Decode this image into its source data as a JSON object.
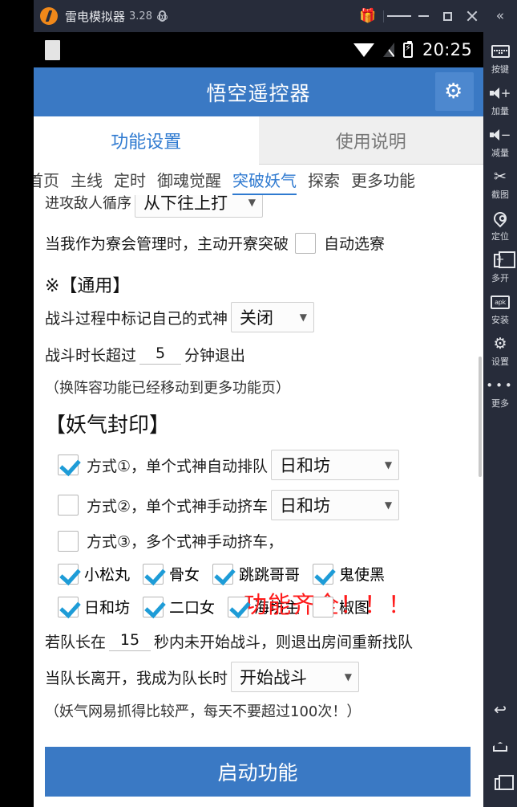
{
  "emulator": {
    "title": "雷电模拟器",
    "version": "3.28",
    "icons": {
      "gift": "🎁",
      "menu": "menu-icon",
      "minimize": "minimize-icon",
      "maximize": "maximize-icon",
      "close": "close-icon",
      "collapse": "«"
    }
  },
  "status_bar": {
    "time": "20:25"
  },
  "app": {
    "title": "悟空遥控器",
    "gear_icon": "⚙",
    "tabs": [
      {
        "label": "功能设置",
        "active": true
      },
      {
        "label": "使用说明",
        "active": false
      }
    ],
    "subtabs": [
      {
        "label": "首页",
        "active": false
      },
      {
        "label": "主线",
        "active": false
      },
      {
        "label": "定时",
        "active": false
      },
      {
        "label": "御魂觉醒",
        "active": false
      },
      {
        "label": "突破妖气",
        "active": true
      },
      {
        "label": "探索",
        "active": false
      },
      {
        "label": "更多功能",
        "active": false
      }
    ],
    "order_row": {
      "label": "进攻敌人循序",
      "value": "从下往上打",
      "caret": "▼"
    },
    "guild_row": {
      "label": "当我作为寮会管理时，主动开寮突破",
      "checkbox_checked": false,
      "checkbox_label": "自动选寮"
    },
    "general": {
      "heading": "※【通用】",
      "mark_label": "战斗过程中标记自己的式神",
      "mark_value": "关闭",
      "duration_prefix": "战斗时长超过",
      "duration_value": "5",
      "duration_suffix": "分钟退出",
      "moved_note": "（换阵容功能已经移动到更多功能页）"
    },
    "seal": {
      "heading": "【妖气封印】",
      "overlay_text": "功能齐全！！！",
      "overlay_color": "#ff1a1a",
      "modes": [
        {
          "checked": true,
          "label": "方式①，单个式神自动排队",
          "select": "日和坊",
          "has_select": true
        },
        {
          "checked": false,
          "label": "方式②，单个式神手动挤车",
          "select": "日和坊",
          "has_select": true
        },
        {
          "checked": false,
          "label": "方式③，多个式神手动挤车，",
          "select": "",
          "has_select": false
        }
      ],
      "shikigami_rows": [
        [
          {
            "label": "小松丸",
            "checked": true
          },
          {
            "label": "骨女",
            "checked": true
          },
          {
            "label": "跳跳哥哥",
            "checked": true
          },
          {
            "label": "鬼使黑",
            "checked": true
          }
        ],
        [
          {
            "label": "日和坊",
            "checked": true
          },
          {
            "label": "二口女",
            "checked": true
          },
          {
            "label": "海坊主",
            "checked": true
          },
          {
            "label": "椒图",
            "checked": false
          }
        ]
      ],
      "leader_timeout_prefix": "若队长在",
      "leader_timeout_value": "15",
      "leader_timeout_suffix": "秒内未开始战斗，则退出房间重新找队",
      "leader_left_label": "当队长离开，我成为队长时",
      "leader_left_value": "开始战斗",
      "warn_note": "（妖气网易抓得比较严，每天不要超过100次！）"
    },
    "start_button": "启动功能"
  },
  "toolbar": {
    "items": [
      {
        "icon": "keyboard-icon",
        "label": "按键"
      },
      {
        "icon": "volume-up-icon",
        "label": "加量"
      },
      {
        "icon": "volume-down-icon",
        "label": "减量"
      },
      {
        "icon": "scissors-icon",
        "label": "截图"
      },
      {
        "icon": "location-pin-icon",
        "label": "定位"
      },
      {
        "icon": "multi-window-icon",
        "label": "多开"
      },
      {
        "icon": "apk-install-icon",
        "label": "安装"
      },
      {
        "icon": "gear-icon",
        "label": "设置"
      },
      {
        "icon": "more-dots-icon",
        "label": "更多"
      }
    ],
    "nav": [
      {
        "icon": "back-icon",
        "glyph": "↩"
      },
      {
        "icon": "home-icon",
        "glyph": ""
      },
      {
        "icon": "recents-icon",
        "glyph": ""
      }
    ]
  },
  "colors": {
    "accent": "#3a79c4",
    "tab_active": "#2f7ad0",
    "chrome": "#272c3a",
    "check": "#1e9cd7"
  }
}
